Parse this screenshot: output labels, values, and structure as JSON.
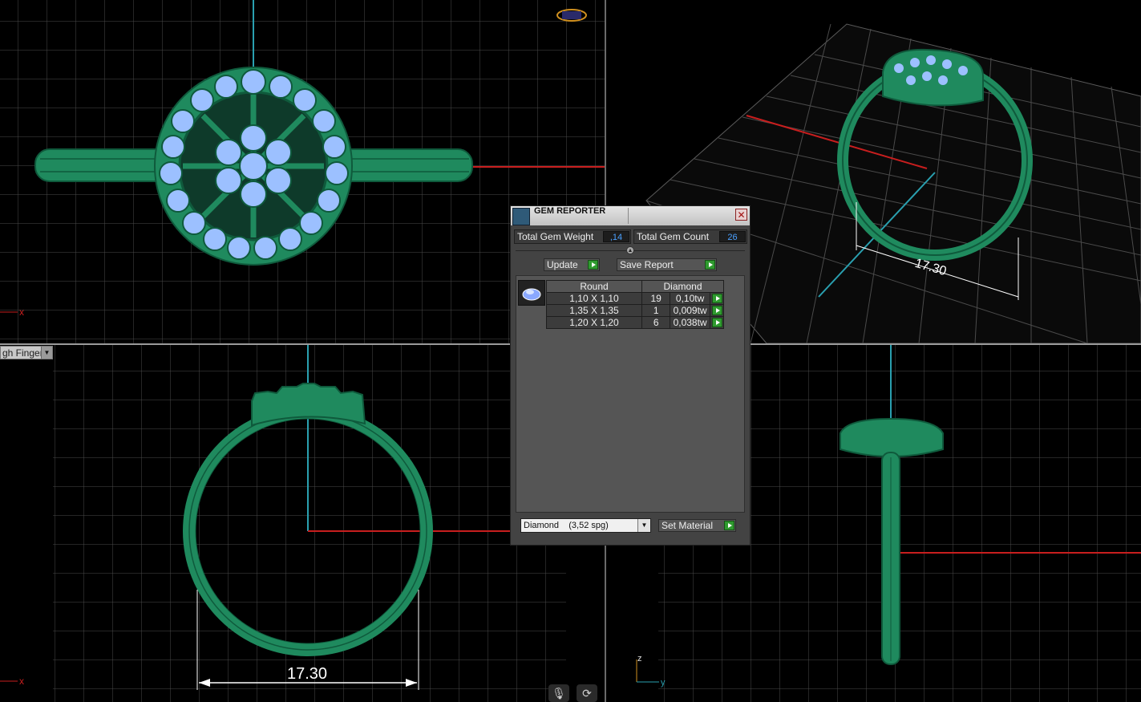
{
  "viewports": {
    "finger_select": "gh Finger",
    "dimension_front": "17.30",
    "dimension_persp": "17.30",
    "axis_x": "x",
    "axis_y": "y",
    "axis_z": "z"
  },
  "dialog": {
    "title": "GEM REPORTER",
    "total_gem_weight_label": "Total Gem Weight",
    "total_gem_weight_value": ",14",
    "total_gem_count_label": "Total Gem Count",
    "total_gem_count_value": "26",
    "update_label": "Update",
    "save_report_label": "Save Report",
    "table": {
      "headers": [
        "Round",
        "Diamond"
      ],
      "rows": [
        {
          "size": "1,10 X 1,10",
          "count": "19",
          "weight": "0,10tw"
        },
        {
          "size": "1,35 X 1,35",
          "count": "1",
          "weight": "0,009tw"
        },
        {
          "size": "1,20 X 1,20",
          "count": "6",
          "weight": "0,038tw"
        }
      ]
    },
    "material_value": "Diamond    (3,52 spg)",
    "set_material_label": "Set Material"
  },
  "colors": {
    "metal": "#1f8a5e",
    "metal_dark": "#0f5a3c",
    "gem": "#9cc0ff",
    "grid": "#4a4a4a",
    "axis_red": "#c81e1e",
    "axis_blue": "#2aa0b0",
    "play_green": "#2f9a2f"
  }
}
